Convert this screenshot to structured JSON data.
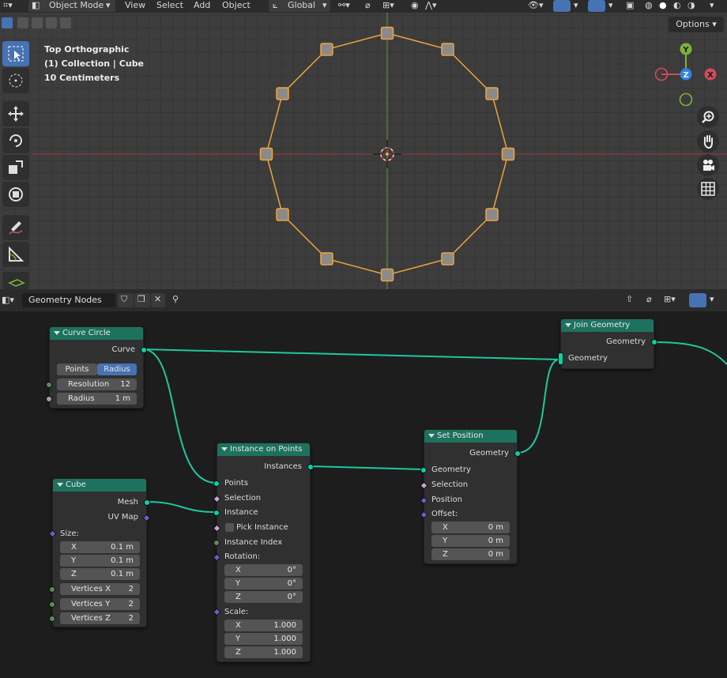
{
  "viewport": {
    "header": {
      "mode": "Object Mode",
      "menus": [
        "View",
        "Select",
        "Add",
        "Object"
      ],
      "transform_orientation": "Global"
    },
    "options_label": "Options",
    "overlay": {
      "view_name": "Top Orthographic",
      "collection": "(1) Collection | Cube",
      "scale": "10 Centimeters"
    },
    "gizmo": {
      "x": "X",
      "y": "Y",
      "z": "Z"
    },
    "tools": [
      "select-box",
      "cursor",
      "move",
      "rotate",
      "scale",
      "transform",
      "annotate",
      "measure",
      "add-cube"
    ],
    "curve_circle_points": 12
  },
  "node_editor": {
    "node_group_name": "Geometry Nodes",
    "nodes": {
      "curve_circle": {
        "title": "Curve Circle",
        "output_curve": "Curve",
        "mode_points": "Points",
        "mode_radius": "Radius",
        "resolution_label": "Resolution",
        "resolution_value": "12",
        "radius_label": "Radius",
        "radius_value": "1 m"
      },
      "cube": {
        "title": "Cube",
        "output_mesh": "Mesh",
        "output_uvmap": "UV Map",
        "size_label": "Size:",
        "size_x": "0.1 m",
        "size_y": "0.1 m",
        "size_z": "0.1 m",
        "vx_label": "Vertices X",
        "vx": "2",
        "vy_label": "Vertices Y",
        "vy": "2",
        "vz_label": "Vertices Z",
        "vz": "2"
      },
      "instance_on_points": {
        "title": "Instance on Points",
        "output_instances": "Instances",
        "in_points": "Points",
        "in_selection": "Selection",
        "in_instance": "Instance",
        "in_pick_instance": "Pick Instance",
        "in_instance_index": "Instance Index",
        "rotation_label": "Rotation:",
        "rot_x": "0°",
        "rot_y": "0°",
        "rot_z": "0°",
        "scale_label": "Scale:",
        "scale_x": "1.000",
        "scale_y": "1.000",
        "scale_z": "1.000"
      },
      "set_position": {
        "title": "Set Position",
        "output_geometry": "Geometry",
        "in_geometry": "Geometry",
        "in_selection": "Selection",
        "in_position": "Position",
        "offset_label": "Offset:",
        "off_x": "0 m",
        "off_y": "0 m",
        "off_z": "0 m"
      },
      "join_geometry": {
        "title": "Join Geometry",
        "output_geometry": "Geometry",
        "in_geometry": "Geometry"
      }
    },
    "axis_labels": {
      "x": "X",
      "y": "Y",
      "z": "Z"
    }
  },
  "colors": {
    "node_header": "#1d725e",
    "geometry_socket": "#00d6a3",
    "selection_orange": "#f0a33a",
    "accent_blue": "#4772b3"
  }
}
